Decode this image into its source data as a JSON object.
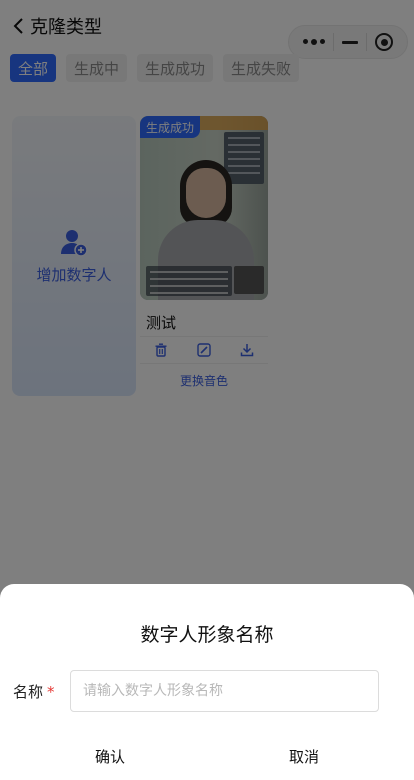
{
  "header": {
    "title": "克隆类型"
  },
  "tabs": [
    {
      "label": "全部",
      "active": true
    },
    {
      "label": "生成中",
      "active": false
    },
    {
      "label": "生成成功",
      "active": false
    },
    {
      "label": "生成失败",
      "active": false
    }
  ],
  "add_card": {
    "label": "增加数字人"
  },
  "video_card": {
    "status": "生成成功",
    "name": "测试",
    "change_voice": "更换音色"
  },
  "dialog": {
    "title": "数字人形象名称",
    "field_label": "名称",
    "required_mark": "*",
    "input_placeholder": "请输入数字人形象名称",
    "input_value": "",
    "confirm_label": "确认",
    "cancel_label": "取消"
  },
  "colors": {
    "accent": "#2f6bff",
    "mask": "rgba(0,0,0,0.5)",
    "required": "#e53935"
  },
  "icons": {
    "back": "chevron-left-icon",
    "more": "more-dots-icon",
    "minimize": "minimize-icon",
    "close": "target-close-icon",
    "add_user": "add-user-icon",
    "delete": "trash-icon",
    "edit": "edit-icon",
    "download": "download-icon"
  }
}
